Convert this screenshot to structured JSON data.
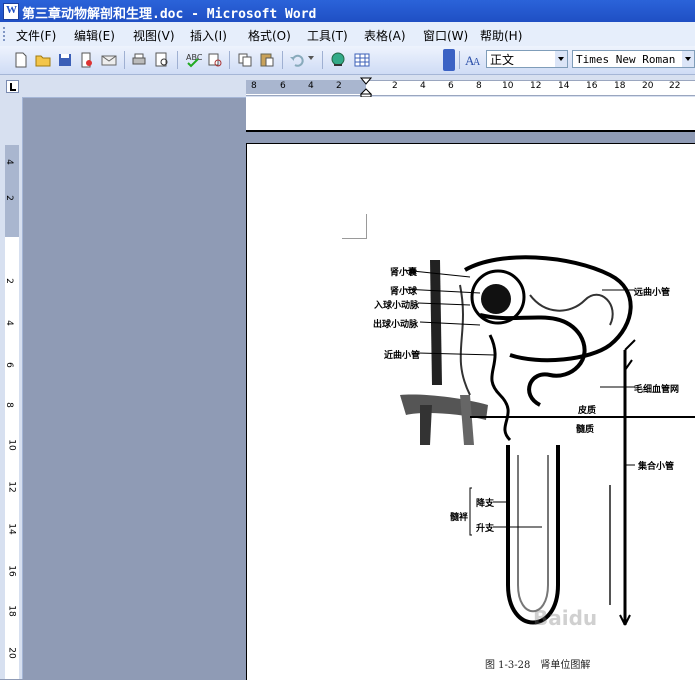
{
  "window": {
    "title": "第三章动物解剖和生理.doc - Microsoft Word"
  },
  "menu": [
    "文件(F)",
    "编辑(E)",
    "视图(V)",
    "插入(I)",
    "格式(O)",
    "工具(T)",
    "表格(A)",
    "窗口(W)",
    "帮助(H)"
  ],
  "toolbar": {
    "style_value": "正文",
    "font_value": "Times New Roman"
  },
  "ruler": {
    "h_ticks": [
      "8",
      "6",
      "4",
      "2",
      "2",
      "4",
      "6",
      "8",
      "10",
      "12",
      "14",
      "16",
      "18",
      "20",
      "22"
    ],
    "v_ticks": [
      "4",
      "2",
      "2",
      "4",
      "6",
      "8",
      "10",
      "12",
      "14",
      "16",
      "18",
      "20"
    ]
  },
  "figure": {
    "labels": {
      "bowman_capsule": "肾小囊",
      "glomerulus": "肾小球",
      "afferent_arteriole": "入球小动脉",
      "efferent_arteriole": "出球小动脉",
      "proximal_tubule": "近曲小管",
      "distal_tubule": "远曲小管",
      "capillary_network": "毛细血管网",
      "cortex": "皮质",
      "medulla": "髓质",
      "collecting_duct": "集合小管",
      "loop": "髓袢",
      "descending_limb": "降支",
      "ascending_limb": "升支"
    },
    "caption": "图 1-3-28　肾单位图解",
    "watermark": "Baidu"
  }
}
